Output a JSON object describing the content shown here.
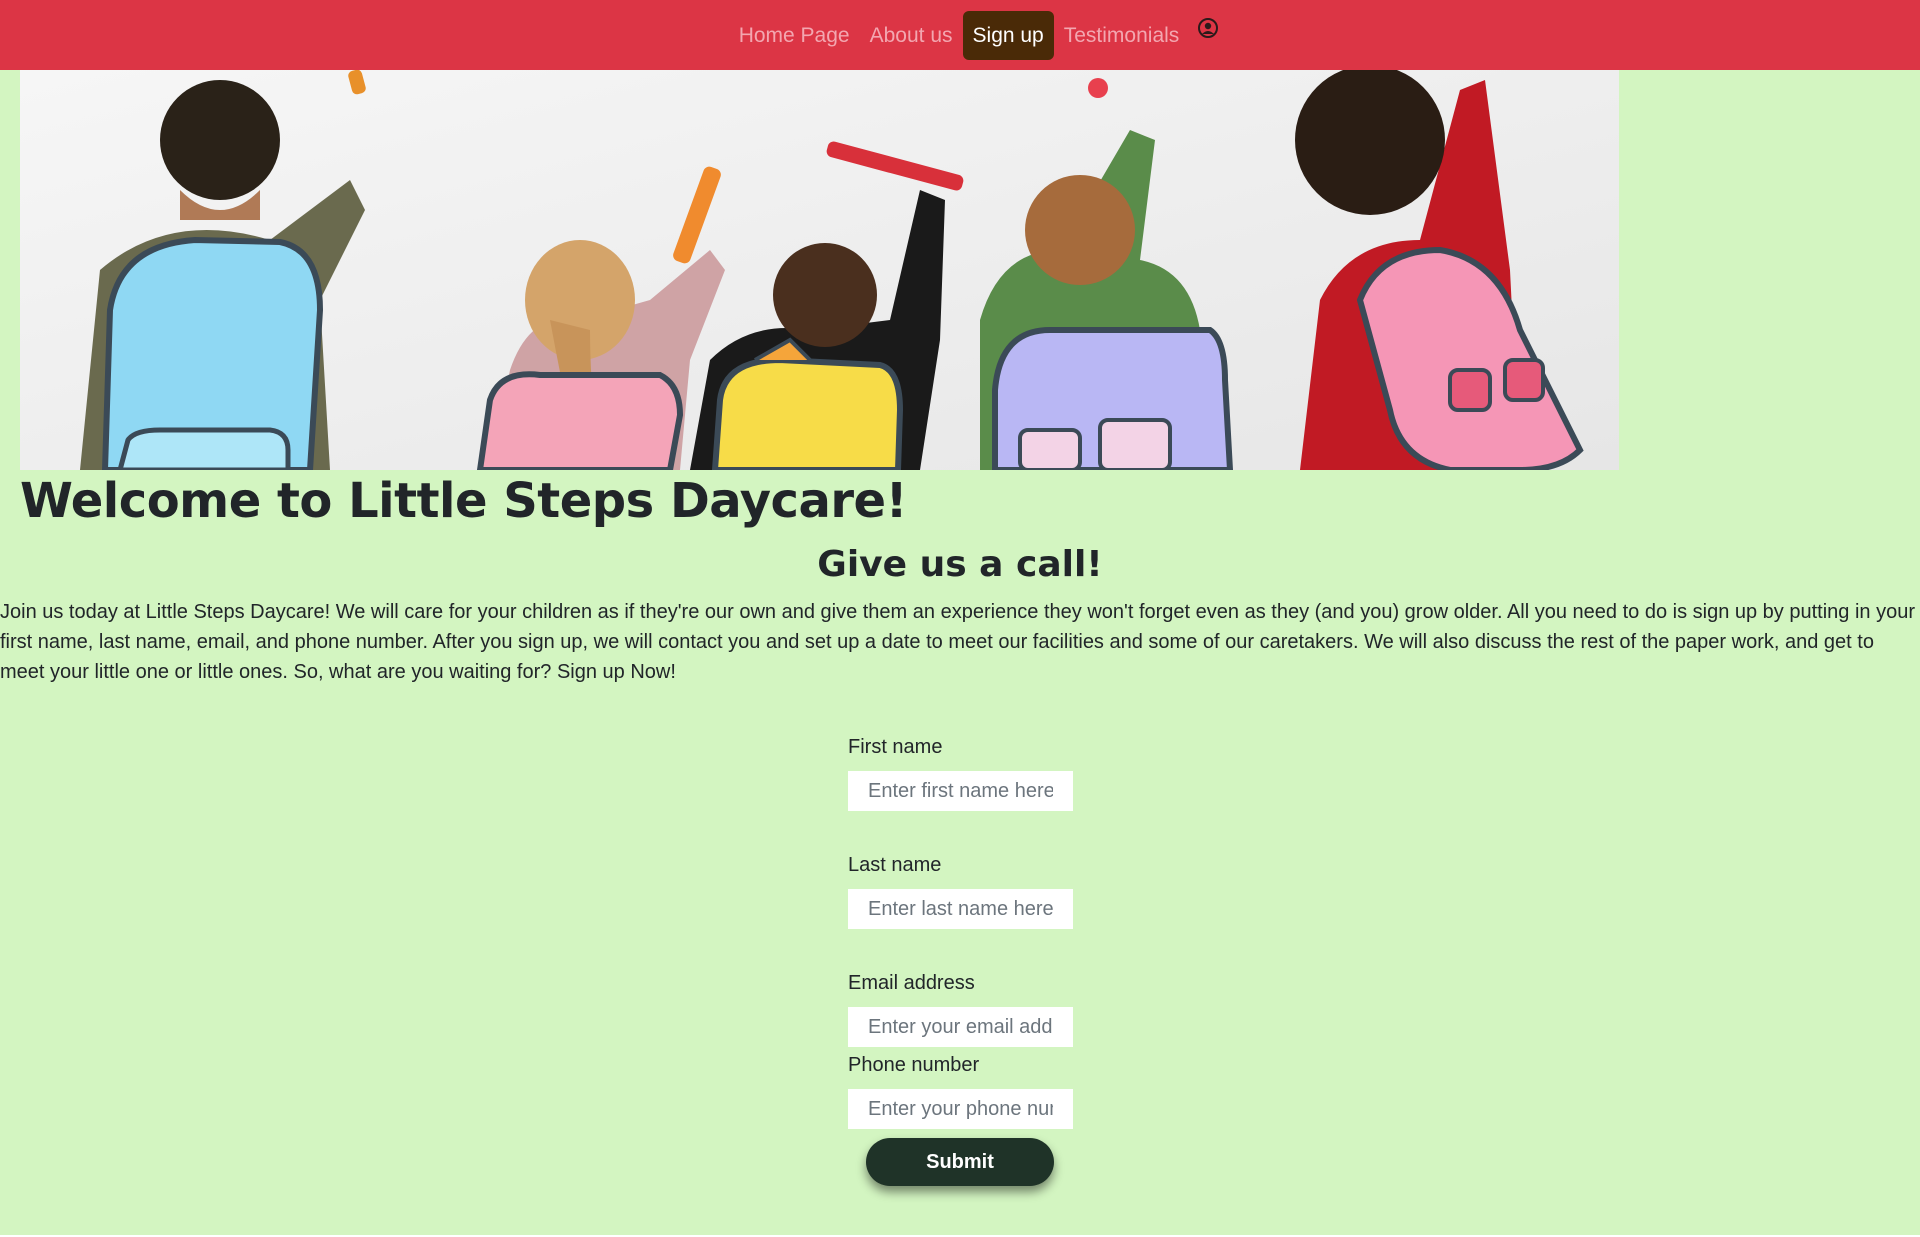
{
  "nav": {
    "items": [
      {
        "label": "Home Page"
      },
      {
        "label": "About us"
      },
      {
        "label": "Sign up",
        "active": true
      },
      {
        "label": "Testimonials"
      }
    ],
    "user_icon": "user-circle-icon"
  },
  "hero": {
    "image_description_icon": "children-drawing-on-wall-photo"
  },
  "welcome_title": "Welcome to Little Steps Daycare!",
  "call_heading": "Give us a call!",
  "intro_text": "Join us today at Little Steps Daycare! We will care for your children as if they're our own and give them an experience they won't forget even as they (and you) grow older. All you need to do is sign up by putting in your first name, last name, email, and phone number. After you sign up, we will contact you and set up a date to meet our facilities and some of our caretakers. We will also discuss the rest of the paper work, and get to meet your little one or little ones. So, what are you waiting for? Sign up Now!",
  "form": {
    "first_name_label": "First name",
    "first_name_placeholder": "Enter first name here",
    "first_name_value": "",
    "last_name_label": "Last name",
    "last_name_placeholder": "Enter last name here",
    "last_name_value": "",
    "email_label": "Email address",
    "email_placeholder": "Enter your email address",
    "email_value": "",
    "phone_label": "Phone number",
    "phone_placeholder": "Enter your phone number",
    "phone_value": "",
    "submit_label": "Submit"
  },
  "colors": {
    "navbar": "#dc3545",
    "nav_active": "#4a2a07",
    "page_background": "#d3f5c1",
    "submit_button": "#1f3328"
  }
}
